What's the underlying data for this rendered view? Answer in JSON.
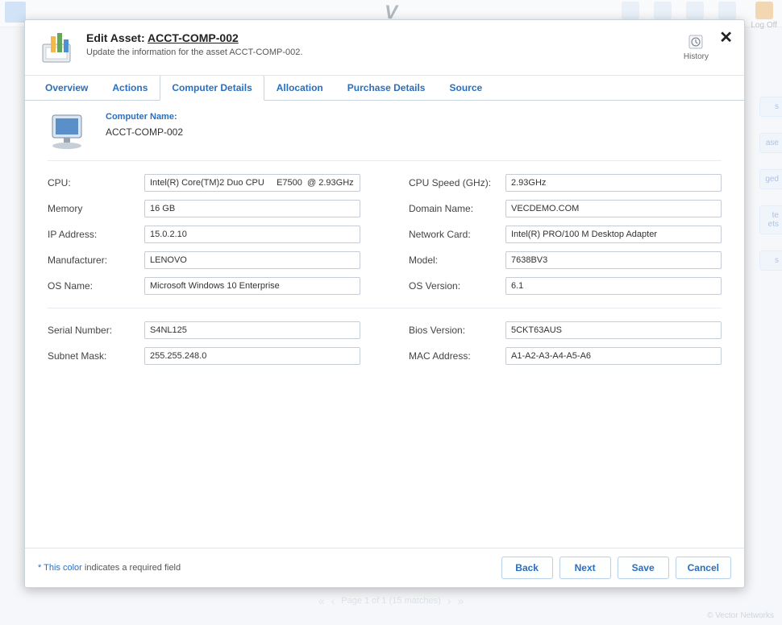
{
  "app": {
    "logoff_label": "Log Off",
    "logo_text": "V",
    "side_labels": [
      "s",
      "ase",
      "ged",
      "te\nets",
      "s"
    ]
  },
  "modal": {
    "title_prefix": "Edit Asset: ",
    "asset_id": "ACCT-COMP-002",
    "subtitle": "Update the information for the asset ACCT-COMP-002.",
    "history_label": "History"
  },
  "tabs": [
    {
      "id": "overview",
      "label": "Overview",
      "active": false
    },
    {
      "id": "actions",
      "label": "Actions",
      "active": false
    },
    {
      "id": "computer-details",
      "label": "Computer Details",
      "active": true
    },
    {
      "id": "allocation",
      "label": "Allocation",
      "active": false
    },
    {
      "id": "purchase-details",
      "label": "Purchase Details",
      "active": false
    },
    {
      "id": "source",
      "label": "Source",
      "active": false
    }
  ],
  "computer": {
    "name_label": "Computer Name:",
    "name_value": "ACCT-COMP-002"
  },
  "fields": {
    "cpu": {
      "label": "CPU:",
      "value": "Intel(R) Core(TM)2 Duo CPU     E7500  @ 2.93GHz"
    },
    "cpu_speed": {
      "label": "CPU Speed (GHz):",
      "value": "2.93GHz"
    },
    "memory": {
      "label": "Memory",
      "value": "16 GB"
    },
    "domain_name": {
      "label": "Domain Name:",
      "value": "VECDEMO.COM"
    },
    "ip_address": {
      "label": "IP Address:",
      "value": "15.0.2.10"
    },
    "network_card": {
      "label": "Network Card:",
      "value": "Intel(R) PRO/100 M Desktop Adapter"
    },
    "manufacturer": {
      "label": "Manufacturer:",
      "value": "LENOVO"
    },
    "model": {
      "label": "Model:",
      "value": "7638BV3"
    },
    "os_name": {
      "label": "OS Name:",
      "value": "Microsoft Windows 10 Enterprise"
    },
    "os_version": {
      "label": "OS Version:",
      "value": "6.1"
    },
    "serial_number": {
      "label": "Serial Number:",
      "value": "S4NL125"
    },
    "bios_version": {
      "label": "Bios Version:",
      "value": "5CKT63AUS"
    },
    "subnet_mask": {
      "label": "Subnet Mask:",
      "value": "255.255.248.0"
    },
    "mac_address": {
      "label": "MAC Address:",
      "value": "A1-A2-A3-A4-A5-A6"
    }
  },
  "footer": {
    "required_star": "*",
    "required_colored": " This color",
    "required_rest": " indicates a required field",
    "buttons": {
      "back": "Back",
      "next": "Next",
      "save": "Save",
      "cancel": "Cancel"
    }
  },
  "pager": {
    "text": "Page 1 of 1 (15 matches)"
  },
  "copyright": "© Vector Networks"
}
